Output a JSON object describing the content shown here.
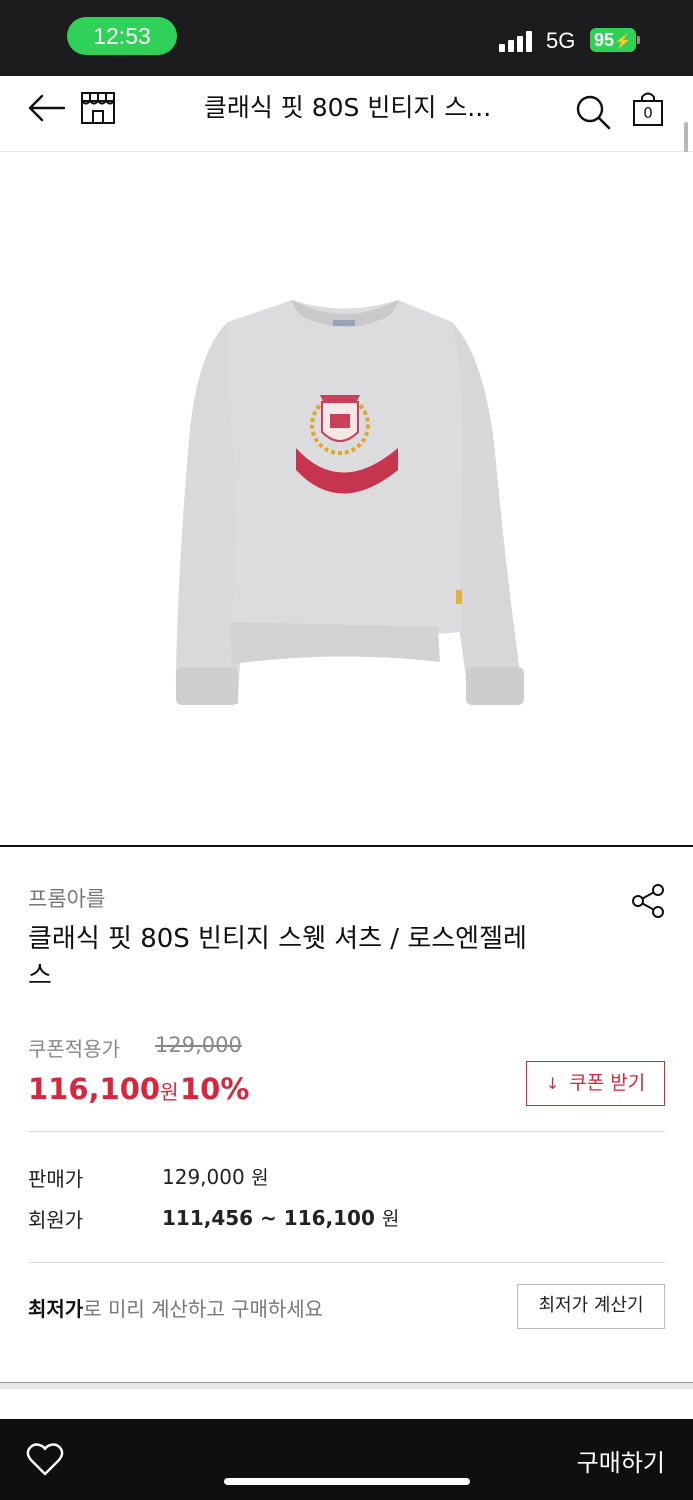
{
  "status_bar": {
    "time": "12:53",
    "network": "5G",
    "battery": "95"
  },
  "nav": {
    "title": "클래식 핏 80S 빈티지 스...",
    "cart_count": "0"
  },
  "hero": {
    "image_alt": "light gray crewneck sweatshirt with red LOS ANGELES crest print"
  },
  "product": {
    "brand": "프롬아를",
    "name_line1": "클래식 핏 80S 빈티지 스웻 셔츠 / 로스엔젤레",
    "name_line2": "스"
  },
  "pricing": {
    "coupon_label": "쿠폰적용가",
    "original_price": "129,000",
    "sale_price": "116,100",
    "won": "원",
    "discount": "10%",
    "coupon_button": "쿠폰 받기",
    "sell_label": "판매가",
    "sell_value": "129,000",
    "member_label": "회원가",
    "member_value": "111,456 ~ 116,100"
  },
  "lowest": {
    "bold_text": "최저가",
    "rest_text": "로 미리 계산하고 구매하세요",
    "button": "최저가 계산기"
  },
  "bottom_bar": {
    "buy_button": "구매하기"
  },
  "colors": {
    "accent_red": "#d7263d",
    "status_green": "#2fd158",
    "bar_dark": "#0f0f0f"
  }
}
